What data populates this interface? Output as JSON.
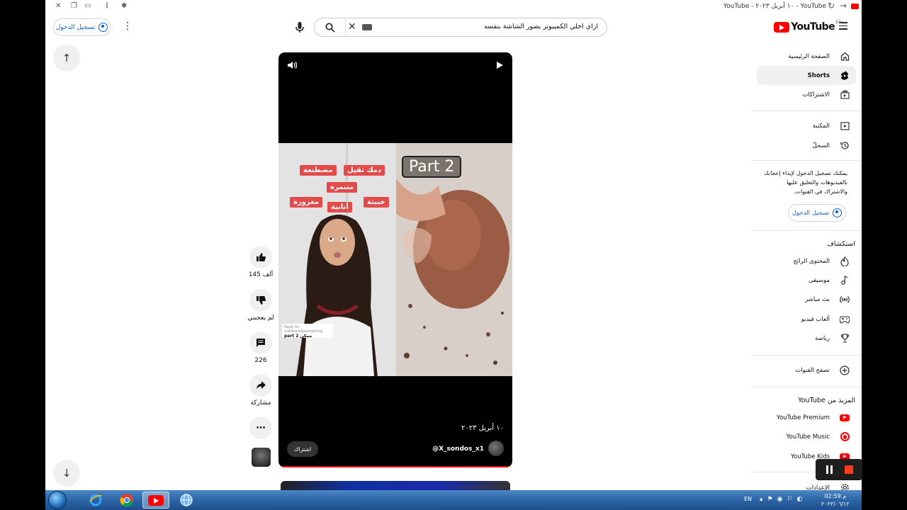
{
  "browser": {
    "tab_title": "YouTube - ١٠ أبريل ٢٠٢٣ - YouTube"
  },
  "header": {
    "logo_text": "YouTube",
    "logo_region": "EG",
    "search_value": "ازاي اخلي الكمبيوتر يصور الشاشة بنفسه",
    "signin_label": "تسجيل الدخول"
  },
  "video": {
    "overlay_text": "Part 2",
    "tags": [
      "مصطنعة",
      "دمك تقيل",
      "متنمرة",
      "مغرورة",
      "أنانية",
      "خبيثة"
    ],
    "reply_sticker_top": "Reply to someone@something",
    "reply_sticker_text": "part 2 ممكن",
    "date": "١٠ أبريل ٢٠٢٣",
    "channel": "@X_sondos_x1",
    "subscribe_label": "اشتراك"
  },
  "actions": {
    "like_count": "145 ألف",
    "dislike_label": "لم يعجبني",
    "comment_count": "226",
    "share_label": "مشاركة"
  },
  "sidebar": {
    "main": [
      {
        "label": "الصفحة الرئيسية",
        "icon": "home-icon"
      },
      {
        "label": "Shorts",
        "icon": "shorts-icon"
      },
      {
        "label": "الاشتراكات",
        "icon": "subscriptions-icon"
      }
    ],
    "library": [
      {
        "label": "المكتبة",
        "icon": "library-icon"
      },
      {
        "label": "السجلّ",
        "icon": "history-icon"
      }
    ],
    "signin_prompt": "يمكنك تسجيل الدخول لإبداء إعجابك بالفيديوهات والتعليق عليها والاشتراك في القنوات.",
    "signin_label": "تسجيل الدخول",
    "explore_title": "استكشاف",
    "explore": [
      {
        "label": "المحتوى الرائج",
        "icon": "trending-icon"
      },
      {
        "label": "موسيقى",
        "icon": "music-icon"
      },
      {
        "label": "بث مباشر",
        "icon": "live-icon"
      },
      {
        "label": "ألعاب فيديو",
        "icon": "gaming-icon"
      },
      {
        "label": "رياضة",
        "icon": "sports-icon"
      }
    ],
    "browse_channels": "تصفح القنوات",
    "more_title": "المزيد من YouTube",
    "more": [
      {
        "label": "YouTube Premium"
      },
      {
        "label": "YouTube Music"
      },
      {
        "label": "YouTube Kids"
      }
    ],
    "settings": "الإعدادات"
  },
  "taskbar": {
    "lang": "EN",
    "time": "02:59 م",
    "date": "٢٠٢٣/٠٦/١٢"
  },
  "colors": {
    "accent_red": "#ff0000",
    "link_blue": "#065fd4",
    "taskbar_blue": "#2d64a6"
  }
}
